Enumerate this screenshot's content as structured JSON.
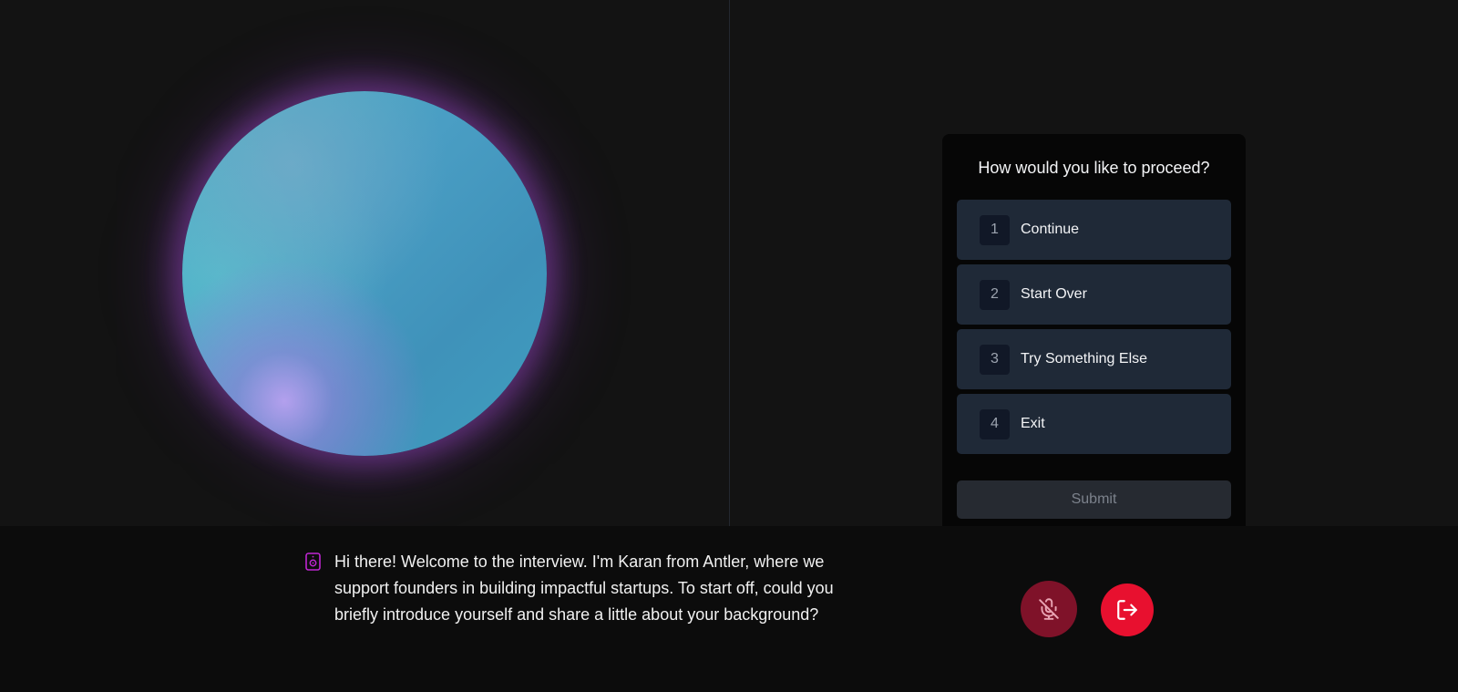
{
  "panel": {
    "title": "How would you like to proceed?",
    "options": [
      {
        "number": "1",
        "label": "Continue"
      },
      {
        "number": "2",
        "label": "Start Over"
      },
      {
        "number": "3",
        "label": "Try Something Else"
      },
      {
        "number": "4",
        "label": "Exit"
      }
    ],
    "submit_label": "Submit"
  },
  "transcript": {
    "text": "Hi there! Welcome to the interview. I'm Karan from Antler, where we support founders in building impactful startups. To start off, could you briefly introduce yourself and share a little about your background?",
    "icon": "speaker-icon"
  },
  "controls": {
    "mic_icon": "mic-off-icon",
    "exit_icon": "exit-icon"
  },
  "colors": {
    "background": "#131313",
    "panel": "#060606",
    "option": "#1f2937",
    "mic_button": "#7f1229",
    "exit_button": "#e8102f",
    "accent_icon": "#c026d3"
  }
}
